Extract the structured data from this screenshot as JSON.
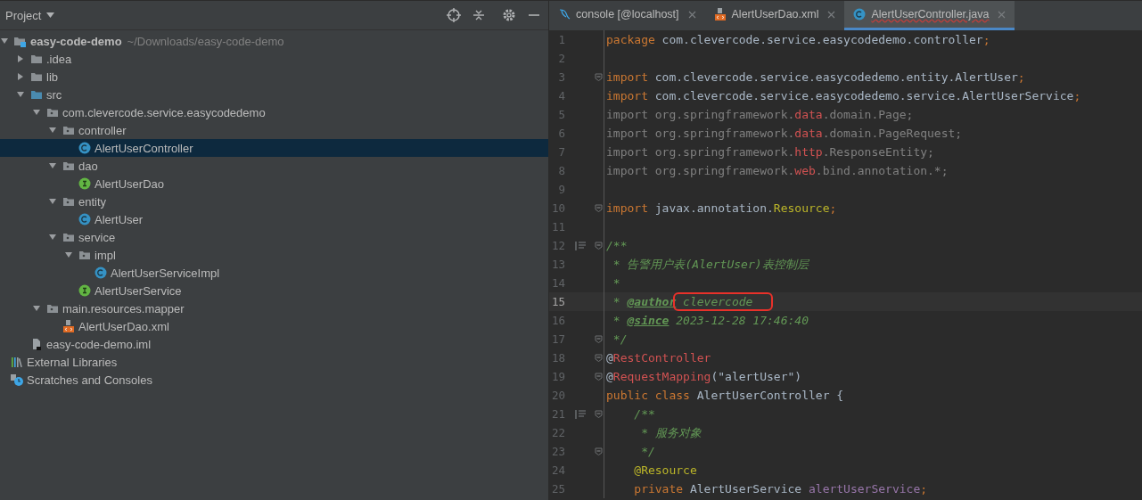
{
  "project_panel": {
    "title": "Project",
    "tree": [
      {
        "label": "easy-code-demo",
        "path": "~/Downloads/easy-code-demo",
        "kind": "module",
        "expanded": true,
        "selected": false,
        "children": [
          {
            "label": ".idea",
            "kind": "folder",
            "expanded": false,
            "selected": false
          },
          {
            "label": "lib",
            "kind": "folder",
            "expanded": false,
            "selected": false
          },
          {
            "label": "src",
            "kind": "source-folder",
            "expanded": true,
            "selected": false,
            "children": [
              {
                "label": "com.clevercode.service.easycodedemo",
                "kind": "package",
                "expanded": true,
                "selected": false,
                "children": [
                  {
                    "label": "controller",
                    "kind": "package",
                    "expanded": true,
                    "selected": false,
                    "children": [
                      {
                        "label": "AlertUserController",
                        "kind": "class",
                        "selected": true
                      }
                    ]
                  },
                  {
                    "label": "dao",
                    "kind": "package",
                    "expanded": true,
                    "selected": false,
                    "children": [
                      {
                        "label": "AlertUserDao",
                        "kind": "interface",
                        "selected": false
                      }
                    ]
                  },
                  {
                    "label": "entity",
                    "kind": "package",
                    "expanded": true,
                    "selected": false,
                    "children": [
                      {
                        "label": "AlertUser",
                        "kind": "class",
                        "selected": false
                      }
                    ]
                  },
                  {
                    "label": "service",
                    "kind": "package",
                    "expanded": true,
                    "selected": false,
                    "children": [
                      {
                        "label": "impl",
                        "kind": "package",
                        "expanded": true,
                        "selected": false,
                        "children": [
                          {
                            "label": "AlertUserServiceImpl",
                            "kind": "class",
                            "selected": false
                          }
                        ]
                      },
                      {
                        "label": "AlertUserService",
                        "kind": "interface",
                        "selected": false
                      }
                    ]
                  }
                ]
              },
              {
                "label": "main.resources.mapper",
                "kind": "package",
                "expanded": true,
                "selected": false,
                "children": [
                  {
                    "label": "AlertUserDao.xml",
                    "kind": "xml",
                    "selected": false
                  }
                ]
              }
            ]
          },
          {
            "label": "easy-code-demo.iml",
            "kind": "iml",
            "selected": false
          }
        ]
      },
      {
        "label": "External Libraries",
        "kind": "libraries",
        "selected": false
      },
      {
        "label": "Scratches and Consoles",
        "kind": "scratches",
        "selected": false
      }
    ]
  },
  "editor": {
    "tabs": [
      {
        "label": "console [@localhost]",
        "kind": "database",
        "selected": false
      },
      {
        "label": "AlertUserDao.xml",
        "kind": "xml",
        "selected": false
      },
      {
        "label": "AlertUserController.java",
        "kind": "class",
        "selected": true
      }
    ],
    "lines": [
      {
        "number": "1",
        "current": false,
        "tokens": [
          {
            "t": "package",
            "kind": "kw"
          },
          {
            "t": " com.clevercode.service.easycodedemo.controller",
            "kind": "plain"
          },
          {
            "t": ";",
            "kind": "kw"
          }
        ]
      },
      {
        "number": "2",
        "current": false
      },
      {
        "number": "3",
        "current": false,
        "fold": true,
        "tokens": [
          {
            "t": "import",
            "kind": "kw"
          },
          {
            "t": " com.clevercode.service.easycodedemo.entity.AlertUser",
            "kind": "plain"
          },
          {
            "t": ";",
            "kind": "kw"
          }
        ]
      },
      {
        "number": "4",
        "current": false,
        "tokens": [
          {
            "t": "import",
            "kind": "kw"
          },
          {
            "t": " com.clevercode.service.easycodedemo.service.AlertUserService",
            "kind": "plain"
          },
          {
            "t": ";",
            "kind": "kw"
          }
        ]
      },
      {
        "number": "5",
        "current": false,
        "tokens": [
          {
            "t": "import org.springframework.",
            "kind": "dim"
          },
          {
            "t": "data",
            "kind": "red"
          },
          {
            "t": ".domain.Page;",
            "kind": "dim"
          }
        ]
      },
      {
        "number": "6",
        "current": false,
        "tokens": [
          {
            "t": "import org.springframework.",
            "kind": "dim"
          },
          {
            "t": "data",
            "kind": "red"
          },
          {
            "t": ".domain.PageRequest;",
            "kind": "dim"
          }
        ]
      },
      {
        "number": "7",
        "current": false,
        "tokens": [
          {
            "t": "import org.springframework.",
            "kind": "dim"
          },
          {
            "t": "http",
            "kind": "red"
          },
          {
            "t": ".ResponseEntity;",
            "kind": "dim"
          }
        ]
      },
      {
        "number": "8",
        "current": false,
        "tokens": [
          {
            "t": "import org.springframework.",
            "kind": "dim"
          },
          {
            "t": "web",
            "kind": "red"
          },
          {
            "t": ".bind.annotation.*;",
            "kind": "dim"
          }
        ]
      },
      {
        "number": "9",
        "current": false
      },
      {
        "number": "10",
        "current": false,
        "fold": true,
        "tokens": [
          {
            "t": "import",
            "kind": "kw"
          },
          {
            "t": " javax.annotation.",
            "kind": "plain"
          },
          {
            "t": "Resource",
            "kind": "yellow"
          },
          {
            "t": ";",
            "kind": "kw"
          }
        ]
      },
      {
        "number": "11",
        "current": false
      },
      {
        "number": "12",
        "current": false,
        "fold": true,
        "doc_icon": true,
        "tokens": [
          {
            "t": "/**",
            "kind": "doc"
          }
        ]
      },
      {
        "number": "13",
        "current": false,
        "tokens": [
          {
            "t": " * 告警用户表(AlertUser)表控制层",
            "kind": "doc"
          }
        ]
      },
      {
        "number": "14",
        "current": false,
        "tokens": [
          {
            "t": " *",
            "kind": "doc"
          }
        ]
      },
      {
        "number": "15",
        "current": true,
        "tokens": [
          {
            "t": " * ",
            "kind": "doc"
          },
          {
            "t": "@author",
            "kind": "doctag"
          },
          {
            "t": " clevercode",
            "kind": "doc",
            "boxed": true
          }
        ]
      },
      {
        "number": "16",
        "current": false,
        "tokens": [
          {
            "t": " * ",
            "kind": "doc"
          },
          {
            "t": "@since",
            "kind": "doctag"
          },
          {
            "t": " 2023-12-28 17:46:40",
            "kind": "doc"
          }
        ]
      },
      {
        "number": "17",
        "current": false,
        "fold": true,
        "tokens": [
          {
            "t": " */",
            "kind": "doc"
          }
        ]
      },
      {
        "number": "18",
        "current": false,
        "fold": true,
        "tokens": [
          {
            "t": "@",
            "kind": "plain"
          },
          {
            "t": "RestController",
            "kind": "red"
          }
        ]
      },
      {
        "number": "19",
        "current": false,
        "fold": true,
        "tokens": [
          {
            "t": "@",
            "kind": "plain"
          },
          {
            "t": "RequestMapping",
            "kind": "red"
          },
          {
            "t": "(\"alertUser\")",
            "kind": "plain"
          }
        ]
      },
      {
        "number": "20",
        "current": false,
        "tokens": [
          {
            "t": "public class ",
            "kind": "kw"
          },
          {
            "t": "AlertUserController",
            "kind": "dim2"
          },
          {
            "t": " {",
            "kind": "plain"
          }
        ]
      },
      {
        "number": "21",
        "current": false,
        "fold": true,
        "doc_icon": true,
        "tokens": [
          {
            "t": "    /**",
            "kind": "doc"
          }
        ]
      },
      {
        "number": "22",
        "current": false,
        "tokens": [
          {
            "t": "     * 服务对象",
            "kind": "doc"
          }
        ]
      },
      {
        "number": "23",
        "current": false,
        "fold": true,
        "tokens": [
          {
            "t": "     */",
            "kind": "doc"
          }
        ]
      },
      {
        "number": "24",
        "current": false,
        "tokens": [
          {
            "t": "    @Resource",
            "kind": "yellow"
          }
        ]
      },
      {
        "number": "25",
        "current": false,
        "tokens": [
          {
            "t": "    private ",
            "kind": "kw"
          },
          {
            "t": "AlertUserService ",
            "kind": "plain"
          },
          {
            "t": "alertUserService",
            "kind": "purple"
          },
          {
            "t": ";",
            "kind": "kw"
          }
        ]
      }
    ]
  }
}
